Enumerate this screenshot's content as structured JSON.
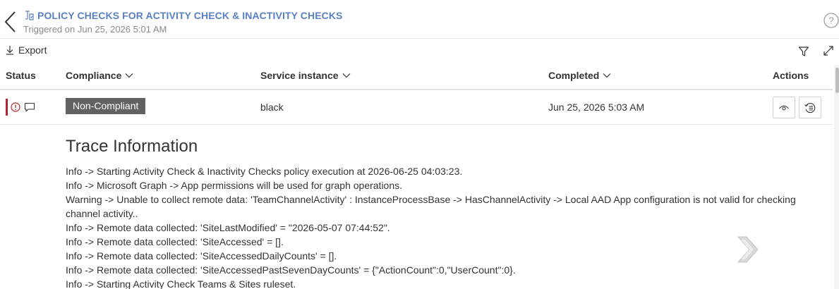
{
  "header": {
    "title": "POLICY CHECKS FOR ACTIVITY CHECK & INACTIVITY CHECKS",
    "subtitle": "Triggered on Jun 25, 2026 5:01 AM"
  },
  "toolbar": {
    "export_label": "Export"
  },
  "table": {
    "columns": {
      "status": "Status",
      "compliance": "Compliance",
      "service_instance": "Service instance",
      "completed": "Completed",
      "actions": "Actions"
    },
    "rows": [
      {
        "compliance": "Non-Compliant",
        "service_instance": "black",
        "completed": "Jun 25, 2026 5:03 AM"
      }
    ]
  },
  "trace": {
    "title": "Trace Information",
    "lines": [
      "Info -> Starting Activity Check & Inactivity Checks policy execution at 2026-06-25 04:03:23.",
      "Info -> Microsoft Graph -> App permissions will be used for graph operations.",
      "Warning -> Unable to collect remote data: 'TeamChannelActivity' : InstanceProcessBase -> HasChannelActivity -> Local AAD App configuration is not valid for checking channel activity..",
      "Info -> Remote data collected: 'SiteLastModified' = \"2026-05-07 07:44:52\".",
      "Info -> Remote data collected: 'SiteAccessed' = [].",
      "Info -> Remote data collected: 'SiteAccessedDailyCounts' = [].",
      "Info -> Remote data collected: 'SiteAccessedPastSevenDayCounts' = {\"ActionCount\":0,\"UserCount\":0}.",
      "Info -> Starting Activity Check Teams & Sites ruleset."
    ]
  },
  "colors": {
    "title_blue": "#5a7fc4",
    "status_red": "#b3242c",
    "badge_gray": "#626262"
  },
  "icons": {
    "back": "chevron-left-icon",
    "title": "policy-icon",
    "help": "help-icon",
    "export": "download-icon",
    "filter": "filter-icon",
    "expand": "expand-icon",
    "status": "alert-circle-icon",
    "comment": "comment-icon",
    "view": "eye-icon",
    "history": "history-icon",
    "nav": "next-arrow-icon"
  }
}
